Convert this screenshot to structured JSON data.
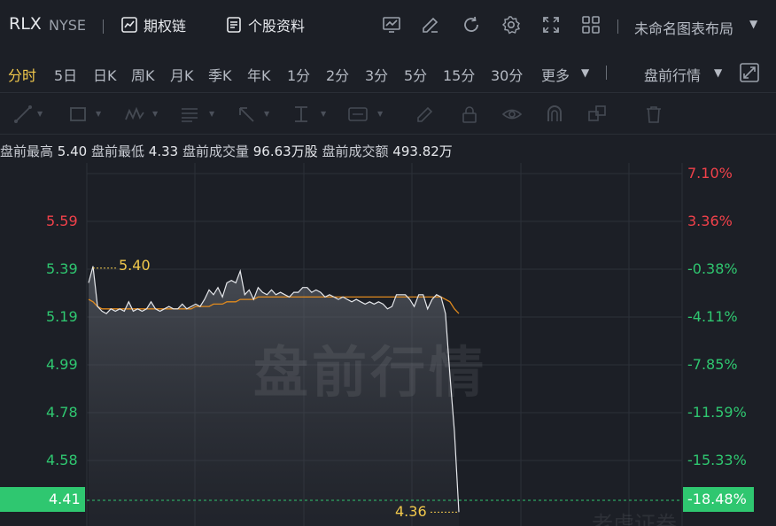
{
  "header": {
    "symbol": "RLX",
    "exchange": "NYSE",
    "options_chain": "期权链",
    "stock_profile": "个股资料",
    "layout_name": "未命名图表布局",
    "icons": [
      "chart-icon",
      "draw-icon",
      "refresh-icon",
      "settings-icon",
      "fullscreen-icon",
      "grid-layout-icon"
    ]
  },
  "periods": {
    "items": [
      "分时",
      "5日",
      "日K",
      "周K",
      "月K",
      "季K",
      "年K",
      "1分",
      "2分",
      "3分",
      "5分",
      "15分",
      "30分",
      "更多"
    ],
    "active": "分时",
    "premarket": "盘前行情"
  },
  "stats": {
    "high_label": "盘前最高",
    "high_value": "5.40",
    "low_label": "盘前最低",
    "low_value": "4.33",
    "volume_label": "盘前成交量",
    "volume_value": "96.63万股",
    "amount_label": "盘前成交额",
    "amount_value": "493.82万"
  },
  "chart": {
    "watermark": "盘前行情",
    "left_ticks": [
      "5.59",
      "5.39",
      "5.19",
      "4.99",
      "4.78",
      "4.58"
    ],
    "right_ticks": [
      "7.10%",
      "3.36%",
      "-0.38%",
      "-4.11%",
      "-7.85%",
      "-11.59%",
      "-15.33%"
    ],
    "current_price": "4.41",
    "current_pct": "-18.48%",
    "high_mark": "5.40",
    "low_mark": "4.36",
    "brand": "老虎证券",
    "colors": {
      "up": "#f0414a",
      "down": "#2fc770",
      "avg": "#e08a1e",
      "marker": "#f2c94c"
    }
  },
  "chart_data": {
    "type": "line",
    "title": "",
    "xlabel": "",
    "ylabel": "",
    "ylim": [
      4.33,
      5.72
    ],
    "series": [
      {
        "values": [
          5.33,
          5.4,
          5.23,
          5.21,
          5.2,
          5.22,
          5.21,
          5.22,
          5.21,
          5.25,
          5.21,
          5.22,
          5.21,
          5.22,
          5.25,
          5.22,
          5.21,
          5.22,
          5.23,
          5.22,
          5.22,
          5.24,
          5.22,
          5.23,
          5.24,
          5.23,
          5.26,
          5.3,
          5.28,
          5.31,
          5.27,
          5.33,
          5.34,
          5.33,
          5.38,
          5.28,
          5.3,
          5.26,
          5.31,
          5.29,
          5.28,
          5.3,
          5.28,
          5.29,
          5.28,
          5.27,
          5.29,
          5.29,
          5.31,
          5.31,
          5.29,
          5.3,
          5.29,
          5.27,
          5.28,
          5.27,
          5.26,
          5.27,
          5.26,
          5.25,
          5.26,
          5.25,
          5.24,
          5.25,
          5.24,
          5.25,
          5.24,
          5.22,
          5.23,
          5.28,
          5.28,
          5.28,
          5.26,
          5.23,
          5.28,
          5.28,
          5.22,
          5.26,
          5.28,
          5.27,
          5.2,
          4.94,
          4.7,
          4.36
        ]
      },
      {
        "values": [
          5.26,
          5.25,
          5.23,
          5.22,
          5.22,
          5.22,
          5.22,
          5.22,
          5.22,
          5.22,
          5.22,
          5.22,
          5.22,
          5.22,
          5.22,
          5.22,
          5.22,
          5.22,
          5.22,
          5.22,
          5.22,
          5.22,
          5.22,
          5.22,
          5.23,
          5.23,
          5.23,
          5.23,
          5.24,
          5.24,
          5.24,
          5.25,
          5.25,
          5.25,
          5.26,
          5.26,
          5.26,
          5.26,
          5.27,
          5.27,
          5.27,
          5.27,
          5.27,
          5.27,
          5.27,
          5.27,
          5.27,
          5.27,
          5.27,
          5.27,
          5.27,
          5.27,
          5.27,
          5.27,
          5.27,
          5.27,
          5.27,
          5.27,
          5.27,
          5.27,
          5.27,
          5.27,
          5.27,
          5.27,
          5.27,
          5.27,
          5.27,
          5.27,
          5.27,
          5.27,
          5.27,
          5.27,
          5.27,
          5.27,
          5.27,
          5.27,
          5.27,
          5.27,
          5.27,
          5.27,
          5.26,
          5.25,
          5.22,
          5.2
        ]
      }
    ]
  }
}
